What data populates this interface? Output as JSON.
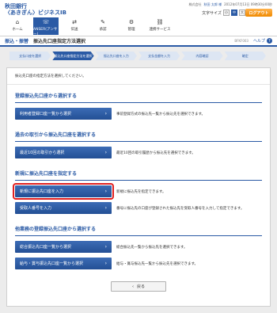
{
  "brand": {
    "line1": "秋田銀行",
    "line2": "〈あきぎん〉ビジネスIB"
  },
  "userbar": {
    "badge": "株式会社",
    "user": "秋田 太郎 様",
    "last_login": "2012年07月13日 09時30分00秒"
  },
  "font_size": {
    "label": "文字サイズ",
    "options": [
      "小",
      "中",
      "大"
    ],
    "selected": "中"
  },
  "logout_label": "ログアウト",
  "nav": [
    {
      "label": "ホーム",
      "icon": "home-icon",
      "glyph": "⌂"
    },
    {
      "label": "ANSER(アンサー)",
      "icon": "phone-icon",
      "glyph": "☏"
    },
    {
      "label": "伝送",
      "icon": "transfer-icon",
      "glyph": "⇄"
    },
    {
      "label": "承認",
      "icon": "approve-icon",
      "glyph": "✎"
    },
    {
      "label": "管理",
      "icon": "admin-icon",
      "glyph": "⚙"
    },
    {
      "label": "連携サービス",
      "icon": "link-icon",
      "glyph": "⛓"
    }
  ],
  "page": {
    "section": "振込・振替",
    "title": "振込先口座指定方法選択",
    "screen_id": "BFKF003",
    "help": "ヘルプ"
  },
  "steps": [
    "支払口座を選択",
    "振込先口座指定方法を選択",
    "振込先口座を入力",
    "支払金額を入力",
    "内容確認",
    "確定"
  ],
  "current_step": 1,
  "instruction": "振込先口座の指定方法を選択してください。",
  "sections": [
    {
      "title": "登録振込先口座から選択する",
      "rows": [
        {
          "button": "利用者登録口座一覧から選択",
          "desc": "事前登録方式の振込先一覧から振込先を選択できます。"
        }
      ]
    },
    {
      "title": "過去の取引から振込先口座を選択する",
      "rows": [
        {
          "button": "最近10回の取引から選択",
          "desc": "最近10回の取引履歴から振込先を選択できます。"
        }
      ]
    },
    {
      "title": "新規に振込先口座を指定する",
      "rows": [
        {
          "button": "新規に振込先口座を入力",
          "desc": "新規に振込先を指定できます。",
          "highlight": true
        },
        {
          "button": "受取人番号を入力",
          "desc": "番号に振込先の口座が登録された振込先を受取人番号を入力して指定できます。"
        }
      ]
    },
    {
      "title": "他業務の登録振込先口座から選択する",
      "rows": [
        {
          "button": "総合振込先口座一覧から選択",
          "desc": "総合振込先一覧から振込先を選択できます。"
        },
        {
          "button": "給与・賞与振込先口座一覧から選択",
          "desc": "給与・賞与振込先一覧から振込先を選択できます。"
        }
      ]
    }
  ],
  "back_label": "戻る"
}
